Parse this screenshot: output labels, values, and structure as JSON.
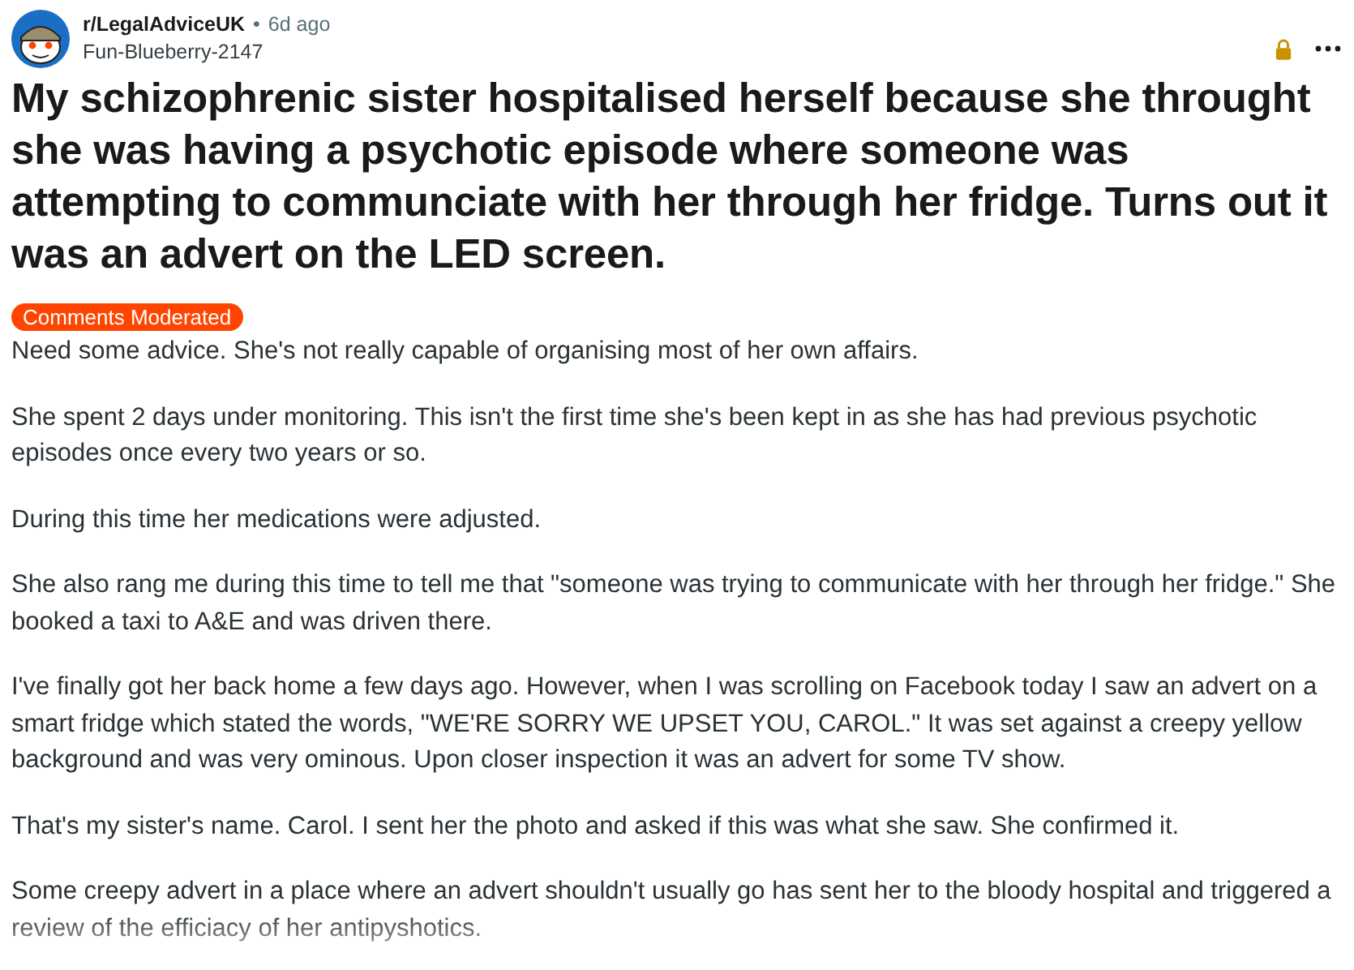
{
  "post": {
    "subreddit": "r/LegalAdviceUK",
    "separator": "•",
    "age": "6d ago",
    "author": "Fun-Blueberry-2147",
    "locked": true,
    "title": "My schizophrenic sister hospitalised herself because she throught she was having a psychotic episode where someone was attempting to communciate with her through her fridge. Turns out it was an advert on the LED screen.",
    "flair": "Comments Moderated",
    "paragraphs": [
      "Need some advice. She's not really capable of organising most of her own affairs.",
      "She spent 2 days under monitoring. This isn't the first time she's been kept in as she has had previous psychotic episodes once every two years or so.",
      "During this time her medications were adjusted.",
      "She also rang me during this time to tell me that \"someone was trying to communicate with her through her fridge.\" She booked a taxi to A&E and was driven there.",
      "I've finally got her back home a few days ago. However, when I was scrolling on Facebook today I saw an advert on a smart fridge which stated the words, \"WE'RE SORRY WE UPSET YOU, CAROL.\" It was set against a creepy yellow background and was very ominous. Upon closer inspection it was an advert for some TV show.",
      "That's my sister's name. Carol. I sent her the photo and asked if this was what she saw. She confirmed it.",
      "Some creepy advert in a place where an advert shouldn't usually go has sent her to the bloody hospital and triggered a review of the efficiacy of her antipyshotics."
    ]
  }
}
